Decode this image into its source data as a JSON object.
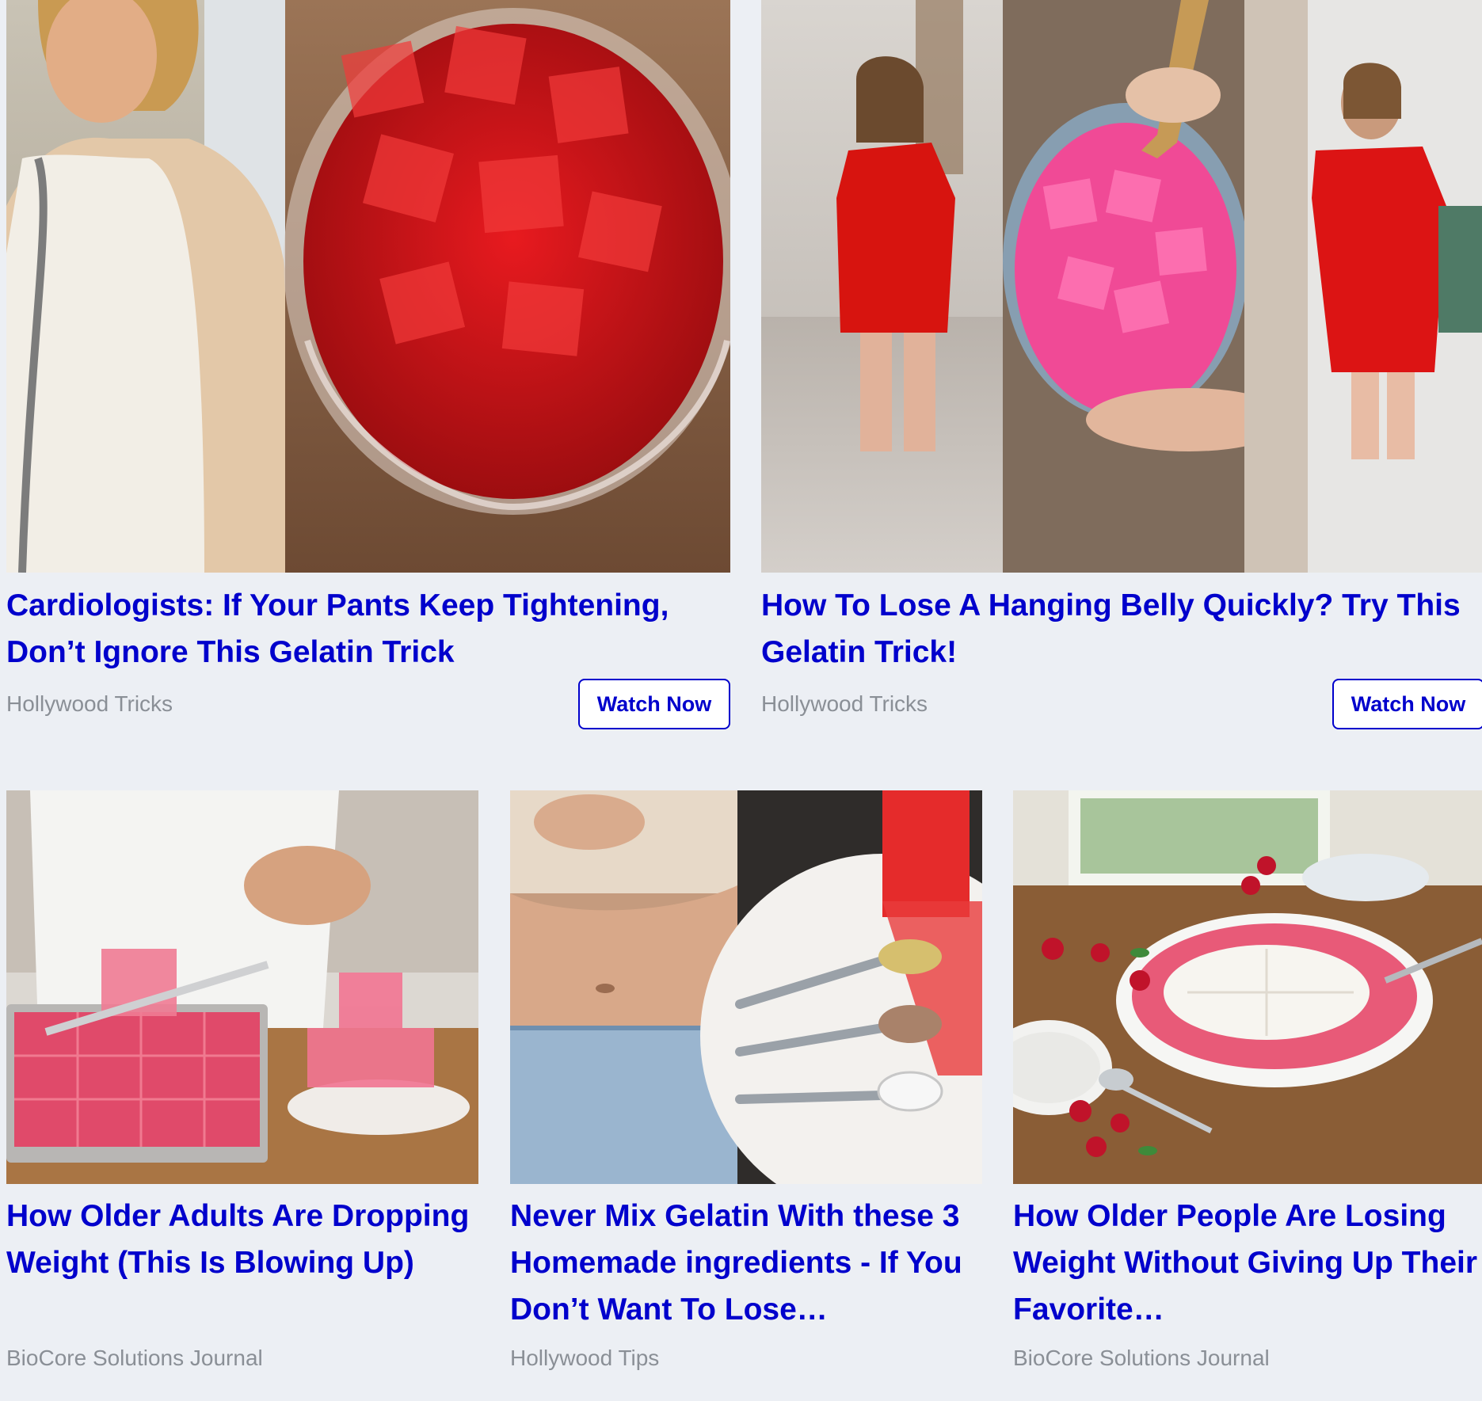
{
  "cards": [
    {
      "title": "Cardiologists: If Your Pants Keep Tightening, Don’t Ignore This Gelatin Trick",
      "source": "Hollywood Tricks",
      "cta_label": "Watch Now",
      "image_alt": "Woman in white dress beside bowl of red gelatin cubes"
    },
    {
      "title": "How To Lose A Hanging Belly Quickly? Try This Gelatin Trick!",
      "source": "Hollywood Tricks",
      "cta_label": "Watch Now",
      "image_alt": "Before and after mirror selfies with bowl of pink gelatin cubes"
    },
    {
      "title": "How Older Adults Are Dropping Weight (This Is Blowing Up)",
      "source": "BioCore Solutions Journal",
      "image_alt": "Cutting pink gelatin cubes in a baking tray"
    },
    {
      "title": "Never Mix Gelatin With these 3 Homemade ingredients - If You Don’t Want To Lose…",
      "source": "Hollywood Tips",
      "image_alt": "Flat stomach next to spoons of powders and gelatin box"
    },
    {
      "title": "How Older People Are Losing Weight Without Giving Up Their Favorite…",
      "source": "BioCore Solutions Journal",
      "image_alt": "Pink gelatin dessert dish with whipped topping and berries"
    }
  ]
}
